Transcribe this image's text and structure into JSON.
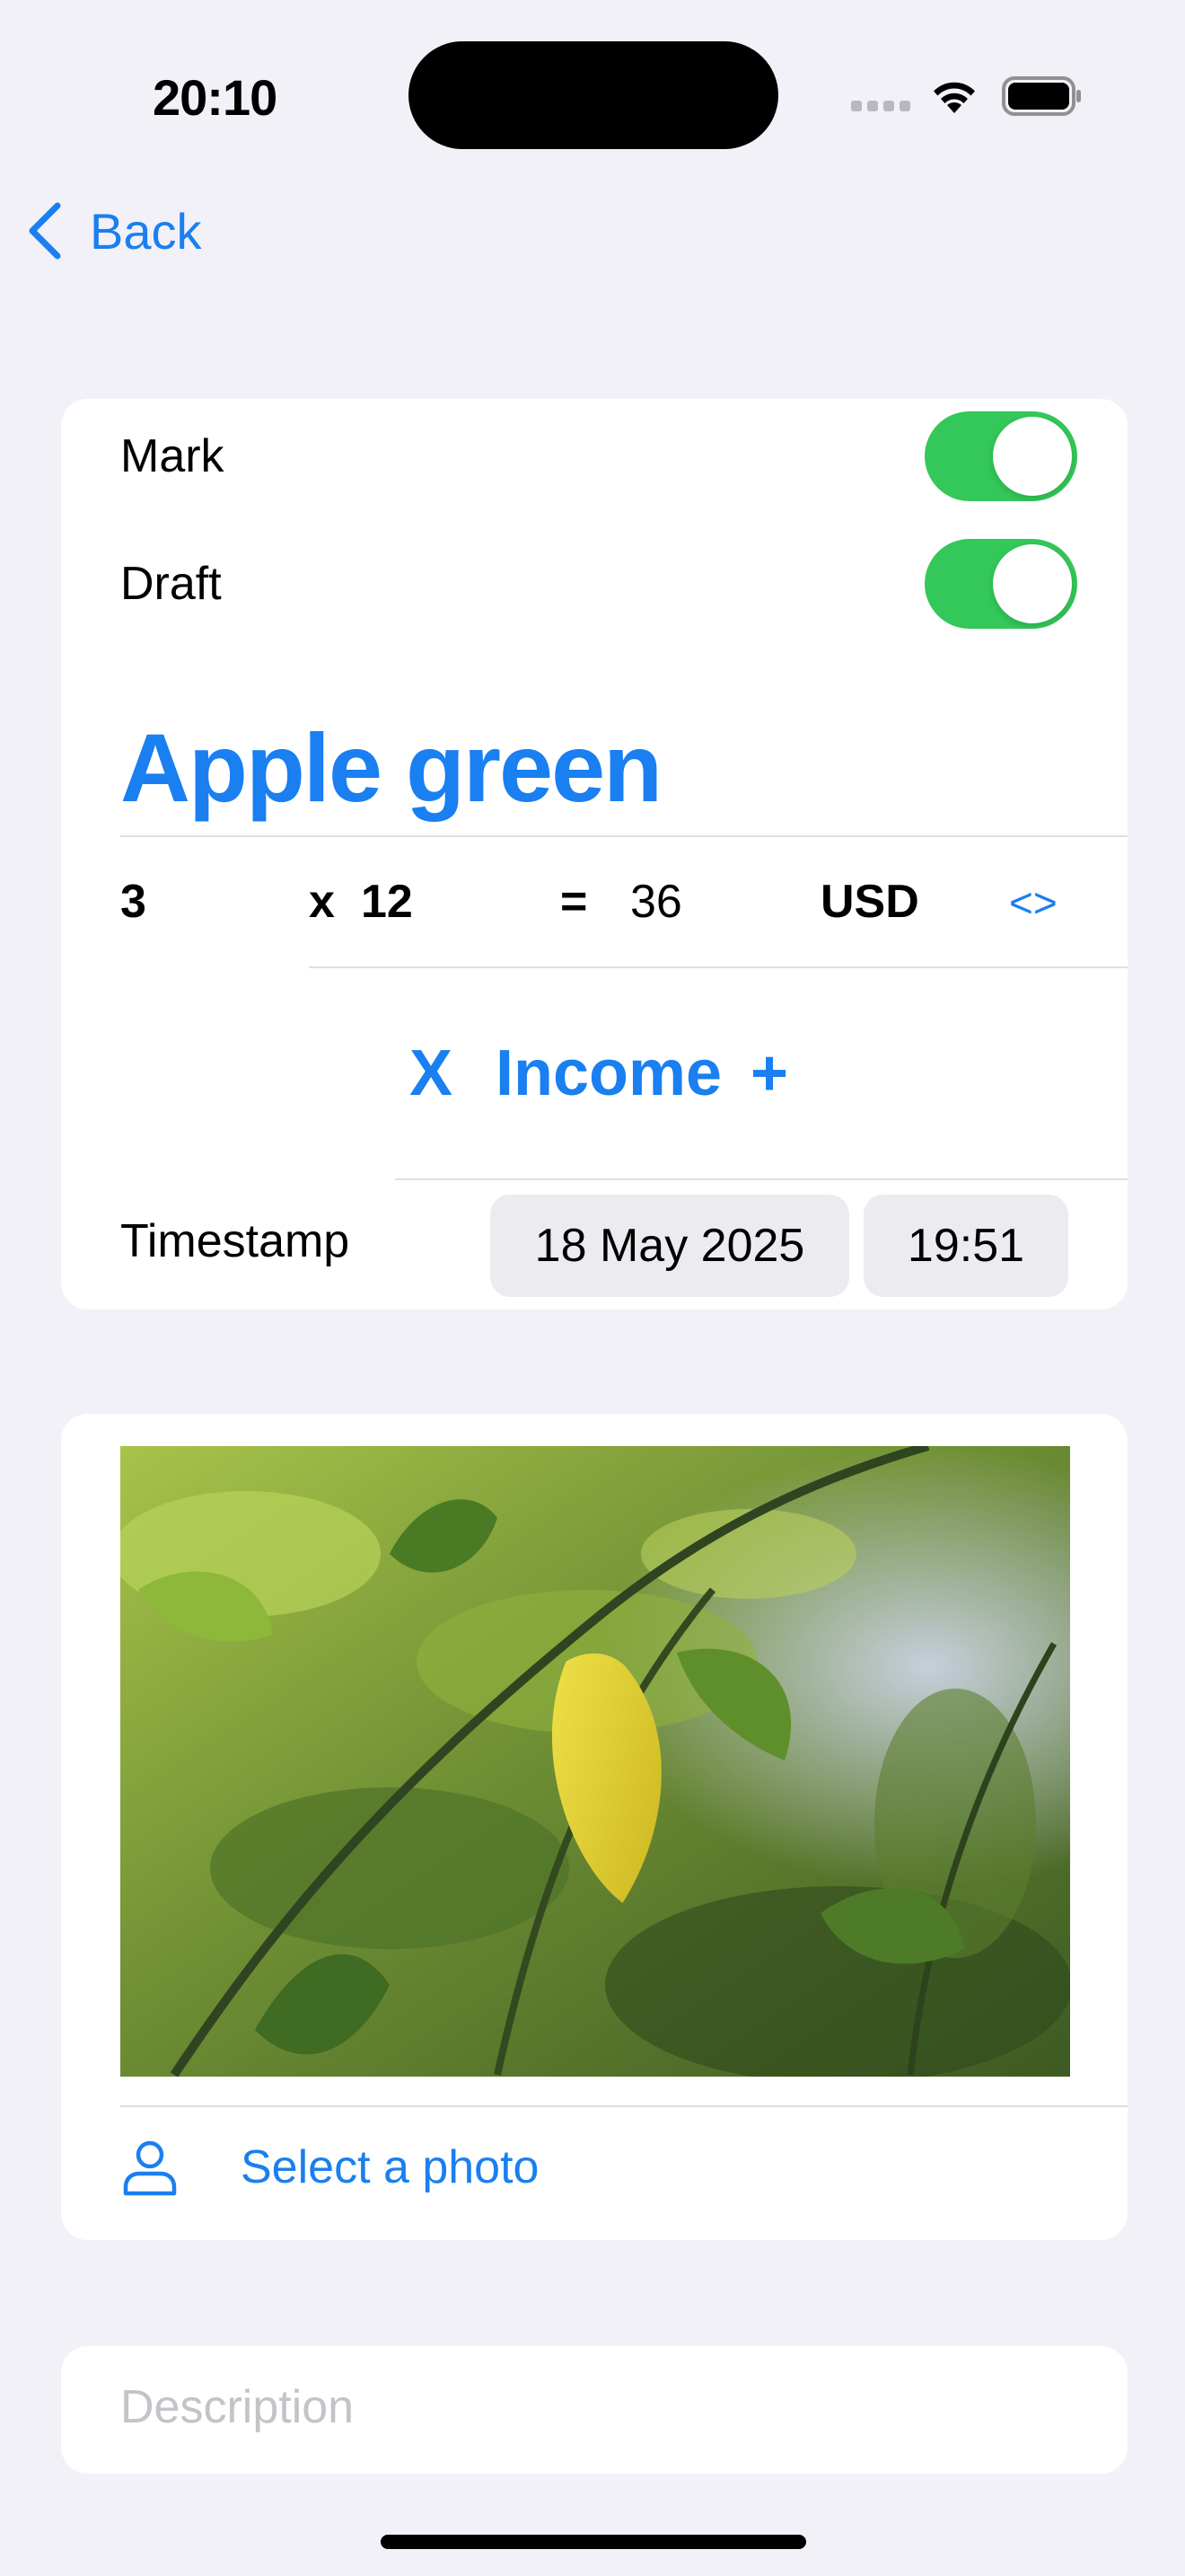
{
  "status_bar": {
    "time": "20:10",
    "icons": [
      "signal-icon",
      "wifi-icon",
      "battery-icon"
    ]
  },
  "nav": {
    "back_label": "Back"
  },
  "toggles": [
    {
      "label": "Mark",
      "on": true
    },
    {
      "label": "Draft",
      "on": true
    }
  ],
  "item": {
    "name": "Apple green",
    "quantity": "3",
    "times": "x",
    "unit_price": "12",
    "equals": "=",
    "total": "36",
    "currency": "USD",
    "swap_label": "<>"
  },
  "type_selector": {
    "clear_label": "X",
    "label": "Income",
    "add_label": "+"
  },
  "timestamp": {
    "label": "Timestamp",
    "date": "18 May 2025",
    "time": "19:51"
  },
  "photo": {
    "select_label": "Select a photo"
  },
  "description": {
    "placeholder": "Description",
    "value": ""
  },
  "colors": {
    "accent": "#1a7ff0",
    "toggle_on": "#34c759",
    "background": "#f2f1f7"
  }
}
